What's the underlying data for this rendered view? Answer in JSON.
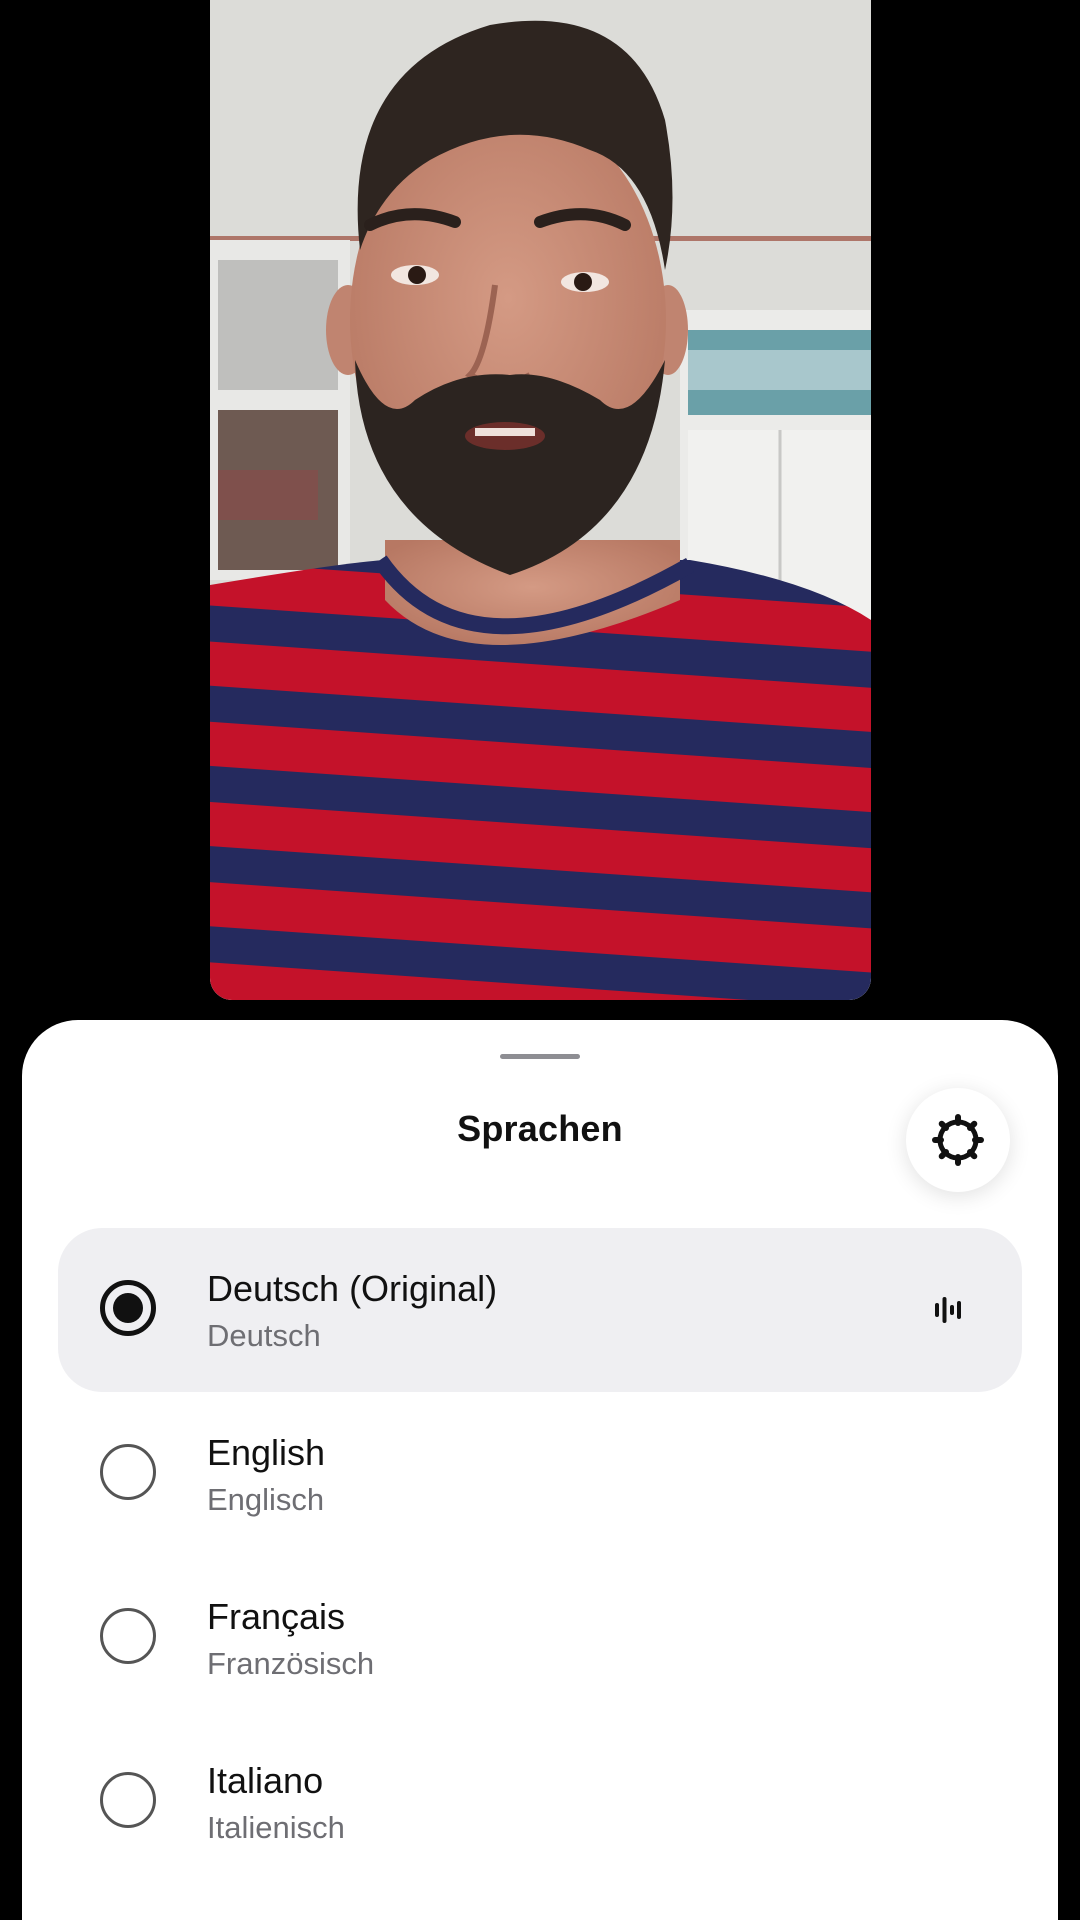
{
  "sheet": {
    "title": "Sprachen",
    "settings_icon": "gear-icon"
  },
  "languages": [
    {
      "name": "Deutsch (Original)",
      "subtitle": "Deutsch",
      "selected": true,
      "indicator_icon": "audio-waveform-icon"
    },
    {
      "name": "English",
      "subtitle": "Englisch",
      "selected": false
    },
    {
      "name": "Français",
      "subtitle": "Französisch",
      "selected": false
    },
    {
      "name": "Italiano",
      "subtitle": "Italienisch",
      "selected": false
    }
  ],
  "colors": {
    "selected_row_bg": "#efeff2",
    "sheet_bg": "#ffffff",
    "backdrop": "#000000",
    "shirt_red": "#c4122a",
    "shirt_navy": "#252a5e"
  }
}
